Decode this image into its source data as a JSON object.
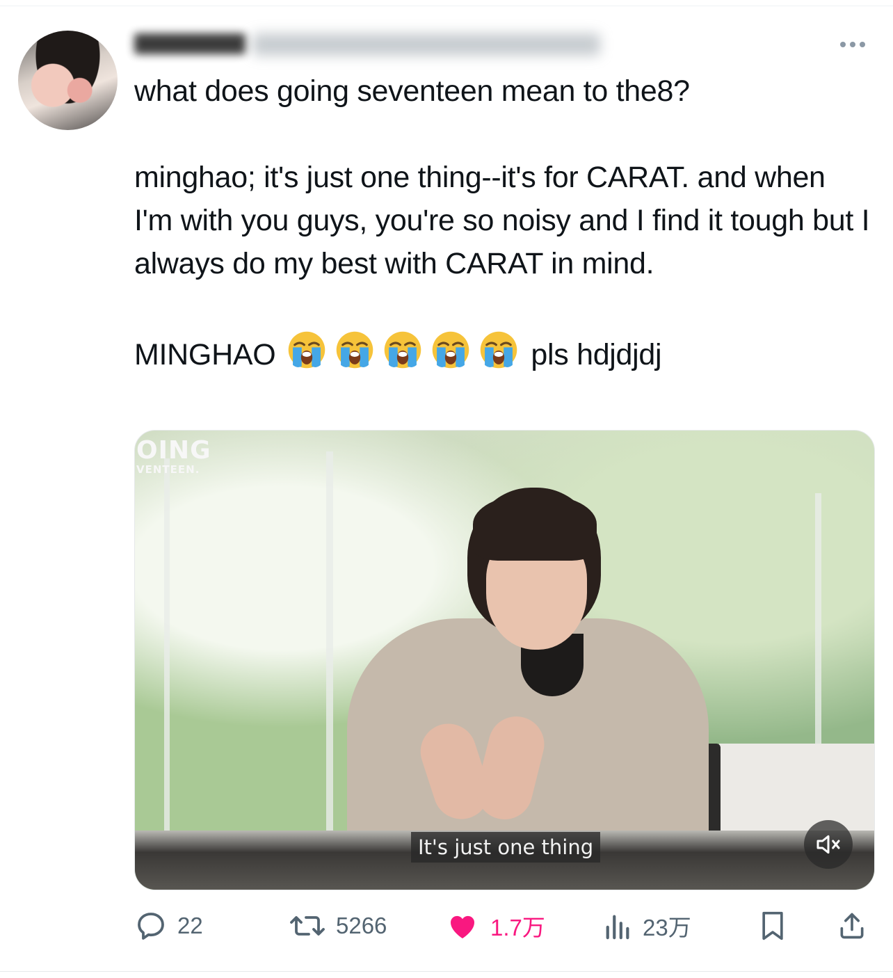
{
  "tweet": {
    "author_name": "hannie",
    "author_handle": "@m",
    "text_lines": [
      "what does going seventeen mean to the8?",
      "minghao; it's just one thing--it's for CARAT. and when I'm with you guys, you're so noisy and I find it tough but I always do my best with CARAT in mind."
    ],
    "exclaim": "MINGHAO",
    "emoji": "😭",
    "emoji_count": 5,
    "tail": "pls hdjdjdj"
  },
  "media": {
    "brand_line1": "OING",
    "brand_line2": "VENTEEN.",
    "subtitle": "It's just one thing",
    "muted_icon": "speaker-muted-icon"
  },
  "actions": {
    "reply_count": "22",
    "retweet_count": "5266",
    "like_count": "1.7万",
    "view_count": "23万"
  },
  "colors": {
    "like_active": "#f91880",
    "secondary_text": "#536471",
    "primary_text": "#0f1419"
  }
}
